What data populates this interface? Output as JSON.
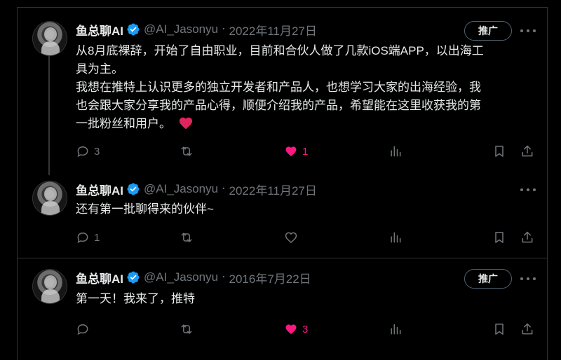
{
  "colors": {
    "background": "#000000",
    "text": "#e7e9ea",
    "muted": "#71767b",
    "verified": "#1d9bf0",
    "like": "#f91880",
    "border": "#2f3336"
  },
  "tweets": [
    {
      "display_name": "鱼总聊AI",
      "handle": "@AI_Jasonyu",
      "date": "2022年11月27日",
      "promote_label": "推广",
      "text_lines": [
        "从8月底裸辞，开始了自由职业，目前和合伙人做了几款iOS端APP，以出海工",
        "具为主。",
        "我想在推特上认识更多的独立开发者和产品人，也想学习大家的出海经验，我",
        "也会跟大家分享我的产品心得，顺便介绍我的产品，希望能在这里收获我的第",
        "一批粉丝和用户。"
      ],
      "emoji": "❤️",
      "reply_count": "3",
      "retweet_count": "",
      "like_count": "1",
      "liked": true
    },
    {
      "display_name": "鱼总聊AI",
      "handle": "@AI_Jasonyu",
      "date": "2022年11月27日",
      "text_lines": [
        "还有第一批聊得来的伙伴~"
      ],
      "reply_count": "1",
      "retweet_count": "",
      "like_count": "",
      "liked": false
    },
    {
      "display_name": "鱼总聊AI",
      "handle": "@AI_Jasonyu",
      "date": "2016年7月22日",
      "promote_label": "推广",
      "text_lines": [
        "第一天！我来了，推特"
      ],
      "reply_count": "",
      "retweet_count": "",
      "like_count": "3",
      "liked": true
    }
  ],
  "icons": [
    "verified-icon",
    "reply-icon",
    "retweet-icon",
    "heart-icon",
    "views-icon",
    "bookmark-icon",
    "share-icon",
    "more-icon"
  ]
}
